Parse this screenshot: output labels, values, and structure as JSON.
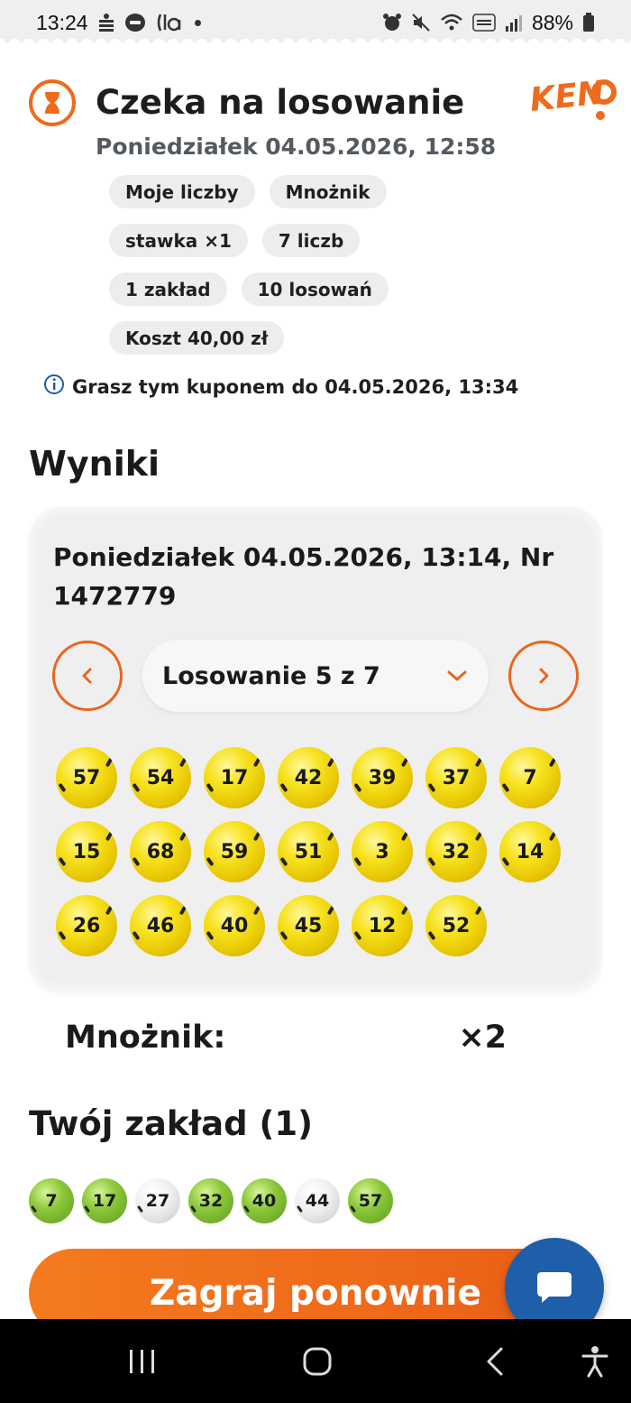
{
  "status_bar": {
    "time": "13:24",
    "battery": "88%"
  },
  "coupon": {
    "title": "Czeka na losowanie",
    "subtitle": "Poniedziałek 04.05.2026, 12:58",
    "logo_text": "KENO",
    "chips": [
      [
        "Moje liczby",
        "Mnożnik"
      ],
      [
        "stawka ×1",
        "7 liczb"
      ],
      [
        "1 zakład",
        "10 losowań"
      ],
      [
        "Koszt 40,00 zł"
      ]
    ],
    "info": "Grasz tym kuponem do 04.05.2026, 13:34"
  },
  "results": {
    "heading": "Wyniki",
    "draw_title": "Poniedziałek 04.05.2026, 13:14, Nr 1472779",
    "draw_select": "Losowanie 5 z 7",
    "numbers": [
      "57",
      "54",
      "17",
      "42",
      "39",
      "37",
      "7",
      "15",
      "68",
      "59",
      "51",
      "3",
      "32",
      "14",
      "26",
      "46",
      "40",
      "45",
      "12",
      "52"
    ]
  },
  "multiplier": {
    "label": "Mnożnik:",
    "value": "×2"
  },
  "bet": {
    "heading": "Twój zakład (1)",
    "numbers": [
      {
        "n": "7",
        "hit": true
      },
      {
        "n": "17",
        "hit": true
      },
      {
        "n": "27",
        "hit": false
      },
      {
        "n": "32",
        "hit": true
      },
      {
        "n": "40",
        "hit": true
      },
      {
        "n": "44",
        "hit": false
      },
      {
        "n": "57",
        "hit": true
      }
    ]
  },
  "play_again": "Zagraj ponownie",
  "colors": {
    "accent": "#ee6a1c",
    "fab": "#1f5ea8",
    "ball_yellow": "#f7e21e",
    "ball_green": "#8cc83a"
  },
  "icons": {
    "status_waiting": "hourglass-icon",
    "info": "info-icon",
    "prev": "chevron-left-icon",
    "next": "chevron-right-icon",
    "dropdown": "chevron-down-icon",
    "chat": "chat-bubble-icon"
  }
}
